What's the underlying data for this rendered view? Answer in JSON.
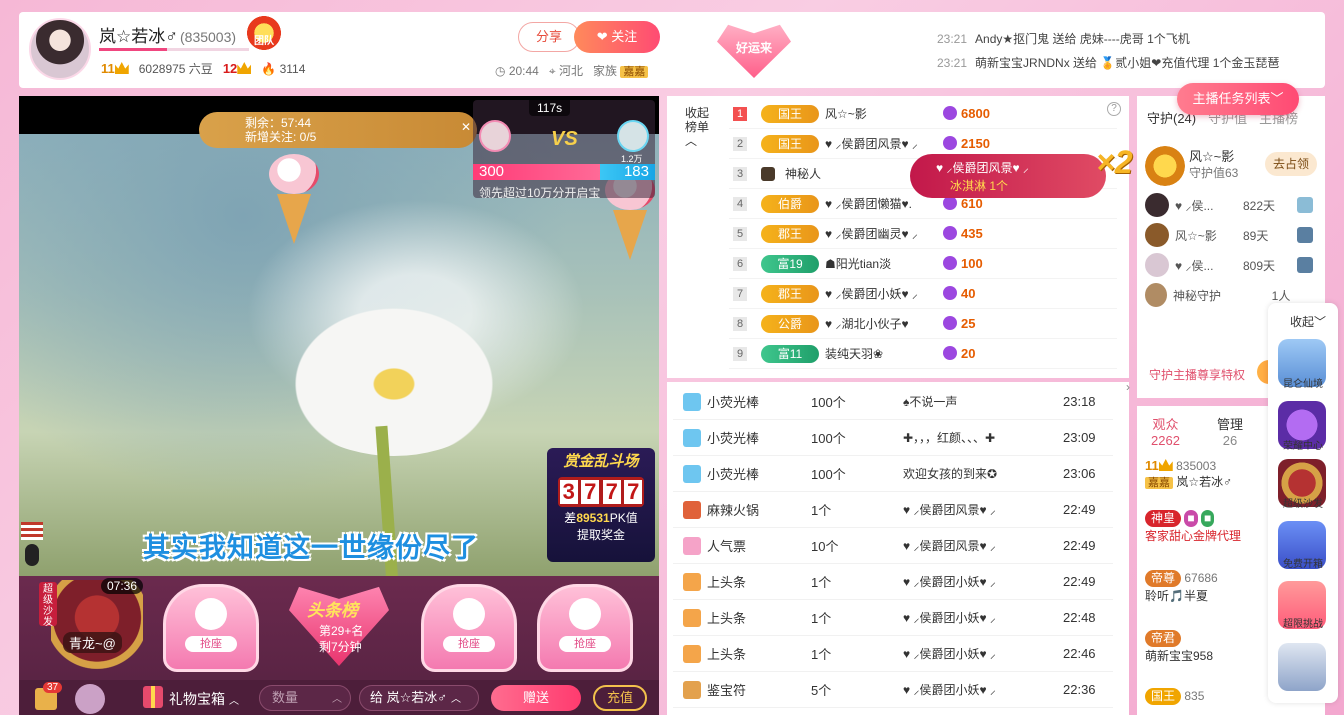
{
  "header": {
    "host_name": "岚☆若冰♂",
    "host_id": "(835003)",
    "team_badge": "团队",
    "wealth_level": "11",
    "beans": "6028975 六豆",
    "fan_level": "12",
    "heat": "3114",
    "share_label": "分享",
    "follow_label": "关注",
    "time": "20:44",
    "location": "河北",
    "family_label": "家族",
    "family_tag": "嘉嘉",
    "luck_label": "好运来"
  },
  "notices": [
    {
      "time": "23:21",
      "text": "Andy★抠门鬼 送给 虎妹----虎哥 1个飞机"
    },
    {
      "time": "23:21",
      "text": "萌新宝宝JRNDNx 送给 🏅贰小姐❤充值代理 1个金玉琵琶"
    }
  ],
  "video": {
    "task_remaining": "剩余：57:44",
    "task_new_follow": "新增关注: 0/5",
    "pk_timer": "117s",
    "pk_vs": "VS",
    "pk_left_score": "300",
    "pk_right_score": "183",
    "pk_right_sub": "1.2万",
    "pk_tip": "领先超过10万分开启宝",
    "lyric": "其实我知道这一世缘份尽了",
    "gold_arena_title": "赏金乱斗场",
    "gold_digits": [
      "3",
      "7",
      "7",
      "7"
    ],
    "gold_gap_prefix": "差",
    "gold_gap_value": "89531",
    "gold_gap_suffix": "PK值",
    "gold_claim": "提取奖金"
  },
  "seats": {
    "sofa_label": "超级沙发",
    "sofa_time": "07:36",
    "sofa_user": "青龙~@",
    "grab_label": "抢座",
    "headline_title": "头条榜",
    "headline_rank": "第29+名",
    "headline_remain": "剩7分钟"
  },
  "toolbar": {
    "bag_count": "37",
    "gift_box": "礼物宝箱",
    "qty_placeholder": "数量",
    "to_label": "给 岚☆若冰♂",
    "send_label": "赠送",
    "recharge_label": "充值"
  },
  "rank": {
    "collapse_label": "收起榜单",
    "rows": [
      {
        "num": "1",
        "badge": "国王",
        "badge_style": "gold",
        "name": "风☆~影",
        "score": "6800"
      },
      {
        "num": "2",
        "badge": "国王",
        "badge_style": "gold",
        "name": "♥ ⸝侯爵团风景♥ ⸝",
        "score": "2150"
      },
      {
        "num": "3",
        "badge": "",
        "badge_style": "mystery",
        "name": "神秘人",
        "score": ""
      },
      {
        "num": "4",
        "badge": "伯爵",
        "badge_style": "gold",
        "name": "♥ ⸝侯爵团懒猫♥.",
        "score": "610"
      },
      {
        "num": "5",
        "badge": "郡王",
        "badge_style": "gold",
        "name": "♥ ⸝侯爵团幽灵♥ ⸝",
        "score": "435"
      },
      {
        "num": "6",
        "badge": "富19",
        "badge_style": "green",
        "name": "☗阳光tian淡",
        "score": "100"
      },
      {
        "num": "7",
        "badge": "郡王",
        "badge_style": "gold",
        "name": "♥ ⸝侯爵团小妖♥ ⸝",
        "score": "40"
      },
      {
        "num": "8",
        "badge": "公爵",
        "badge_style": "gold",
        "name": "♥ ⸝湖北小伙子♥",
        "score": "25"
      },
      {
        "num": "9",
        "badge": "富11",
        "badge_style": "green",
        "name": "装纯天羽❀",
        "score": "20"
      }
    ],
    "popup_name": "♥ ⸝侯爵团风景♥ ⸝",
    "popup_gift": "冰淇淋 1个",
    "popup_multiplier": "×2"
  },
  "gifts": [
    {
      "name": "小荧光棒",
      "count": "100个",
      "from": "♠不说一声",
      "time": "23:18",
      "color": "#6ec6f0"
    },
    {
      "name": "小荧光棒",
      "count": "100个",
      "from": "✚，，，红颜、、、✚",
      "time": "23:09",
      "color": "#6ec6f0"
    },
    {
      "name": "小荧光棒",
      "count": "100个",
      "from": "欢迎女孩的到来✪",
      "time": "23:06",
      "color": "#6ec6f0"
    },
    {
      "name": "麻辣火锅",
      "count": "1个",
      "from": "♥ ⸝侯爵团风景♥ ⸝",
      "time": "22:49",
      "color": "#e0623a"
    },
    {
      "name": "人气票",
      "count": "10个",
      "from": "♥ ⸝侯爵团风景♥ ⸝",
      "time": "22:49",
      "color": "#f5a3c8"
    },
    {
      "name": "上头条",
      "count": "1个",
      "from": "♥ ⸝侯爵团小妖♥ ⸝",
      "time": "22:49",
      "color": "#f4a54a"
    },
    {
      "name": "上头条",
      "count": "1个",
      "from": "♥ ⸝侯爵团小妖♥ ⸝",
      "time": "22:48",
      "color": "#f4a54a"
    },
    {
      "name": "上头条",
      "count": "1个",
      "from": "♥ ⸝侯爵团小妖♥ ⸝",
      "time": "22:46",
      "color": "#f4a54a"
    },
    {
      "name": "鉴宝符",
      "count": "5个",
      "from": "♥ ⸝侯爵团小妖♥ ⸝",
      "time": "22:36",
      "color": "#e3a14d"
    }
  ],
  "guard": {
    "tab_guard": "守护(24)",
    "tab_values": "守护值",
    "tab_host_rank": "主播榜",
    "task_list": "主播任务列表",
    "top_name": "风☆~影",
    "top_value": "守护值63",
    "grab_label": "去占领",
    "rows": [
      {
        "name": "♥ ⸝侯...",
        "days": "822天"
      },
      {
        "name": "风☆~影",
        "days": "89天"
      },
      {
        "name": "♥ ⸝侯...",
        "days": "809天"
      },
      {
        "name": "神秘守护",
        "days": "1人"
      }
    ],
    "privilege": "守护主播尊享特权",
    "privilege_btn": "开"
  },
  "audience": {
    "tab_audience": "观众",
    "audience_count": "2262",
    "tab_manager": "管理",
    "manager_count": "26",
    "u1_level": "11",
    "u1_id": "835003",
    "u1_family": "嘉嘉",
    "u1_name": "岚☆若冰♂",
    "u2_noble": "神皇",
    "u2_name": "客家甜心金牌代理",
    "u3_noble": "帝尊",
    "u3_id": "67686",
    "u3_name": "聆听🎵半夏",
    "u4_noble": "帝君",
    "u4_name": "萌新宝宝958",
    "u5_noble": "国王",
    "u5_id": "835"
  },
  "float_bar": {
    "collapse": "收起",
    "items": [
      "昆仑仙境",
      "荣耀中心",
      "超级沙发",
      "免费开箱",
      "超限挑战",
      ""
    ]
  }
}
